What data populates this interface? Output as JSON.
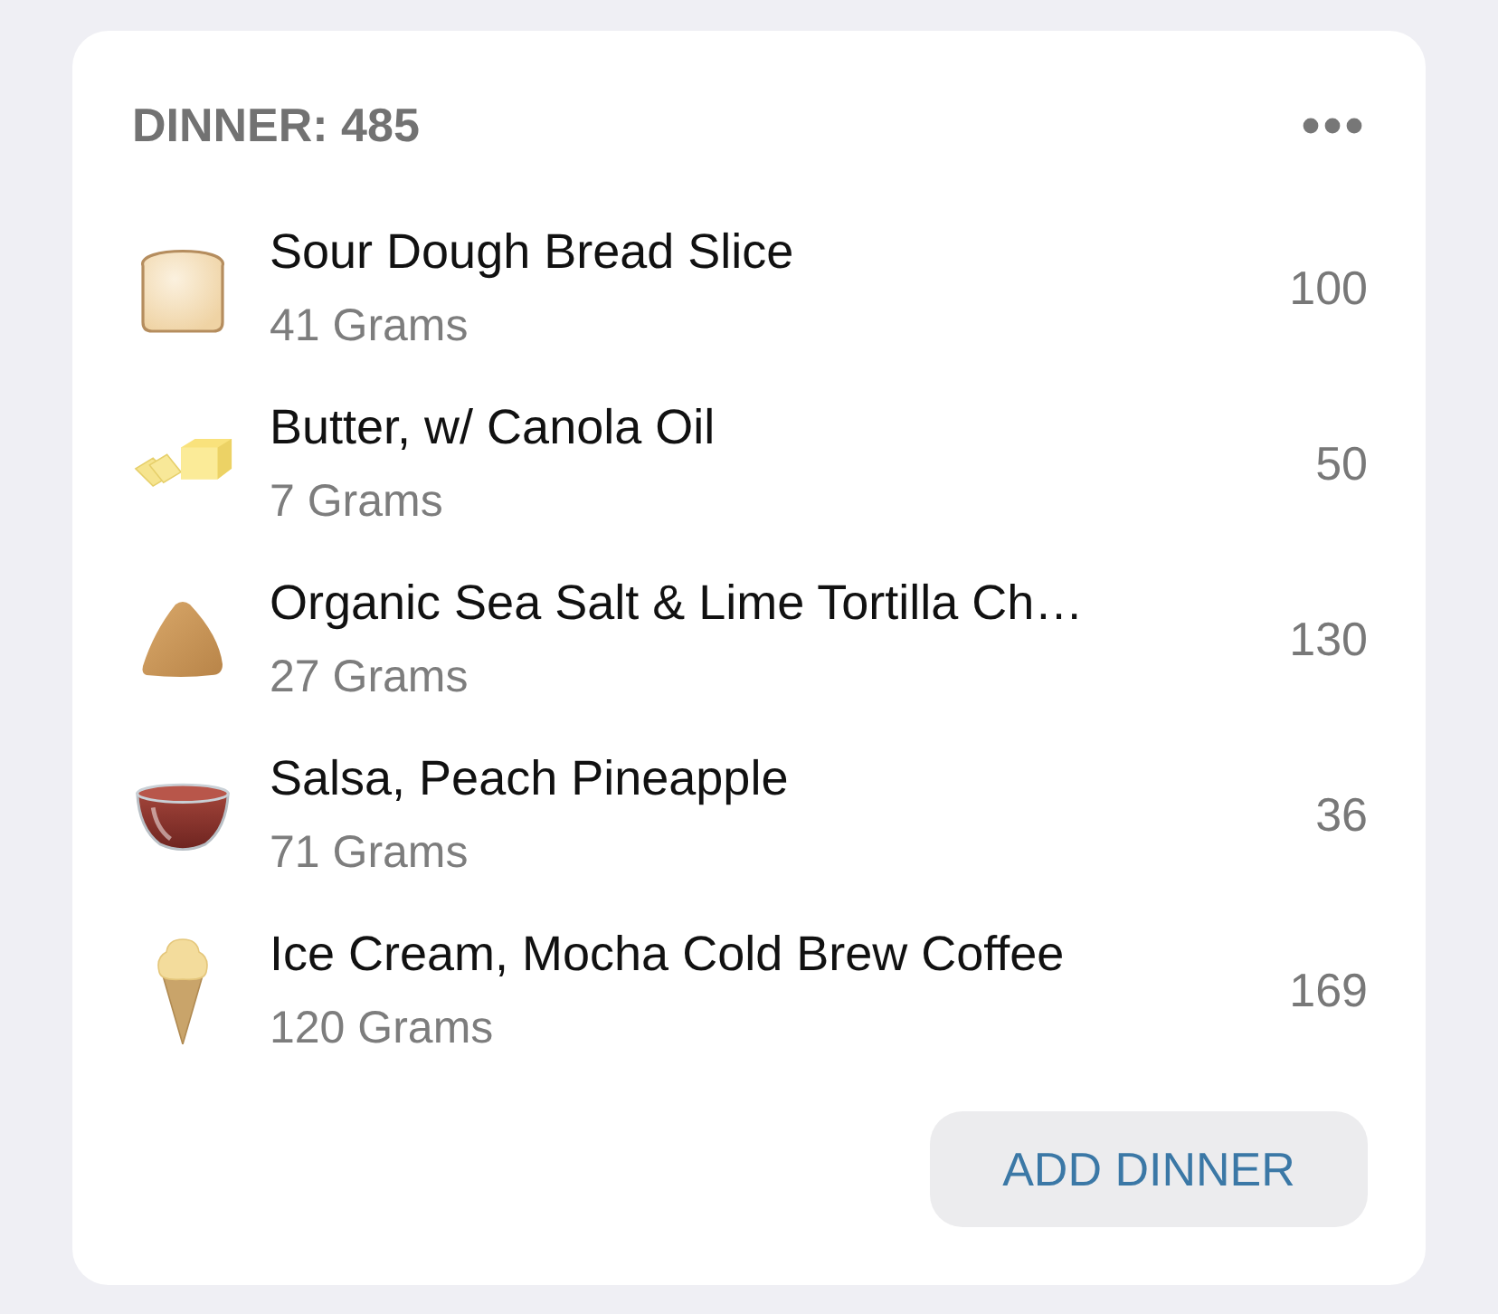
{
  "meal": {
    "title": "DINNER: 485"
  },
  "items": [
    {
      "kind": "bread",
      "name": "Sour Dough Bread Slice",
      "amount": "41 Grams",
      "calories": "100"
    },
    {
      "kind": "butter",
      "name": "Butter, w/ Canola Oil",
      "amount": "7 Grams",
      "calories": "50"
    },
    {
      "kind": "chip",
      "name": "Organic Sea Salt & Lime Tortilla Ch…",
      "amount": "27 Grams",
      "calories": "130"
    },
    {
      "kind": "salsa",
      "name": "Salsa, Peach Pineapple",
      "amount": "71 Grams",
      "calories": "36"
    },
    {
      "kind": "icecream",
      "name": "Ice Cream, Mocha Cold Brew Coffee",
      "amount": "120 Grams",
      "calories": "169"
    }
  ],
  "add_button": {
    "label": "ADD DINNER"
  }
}
